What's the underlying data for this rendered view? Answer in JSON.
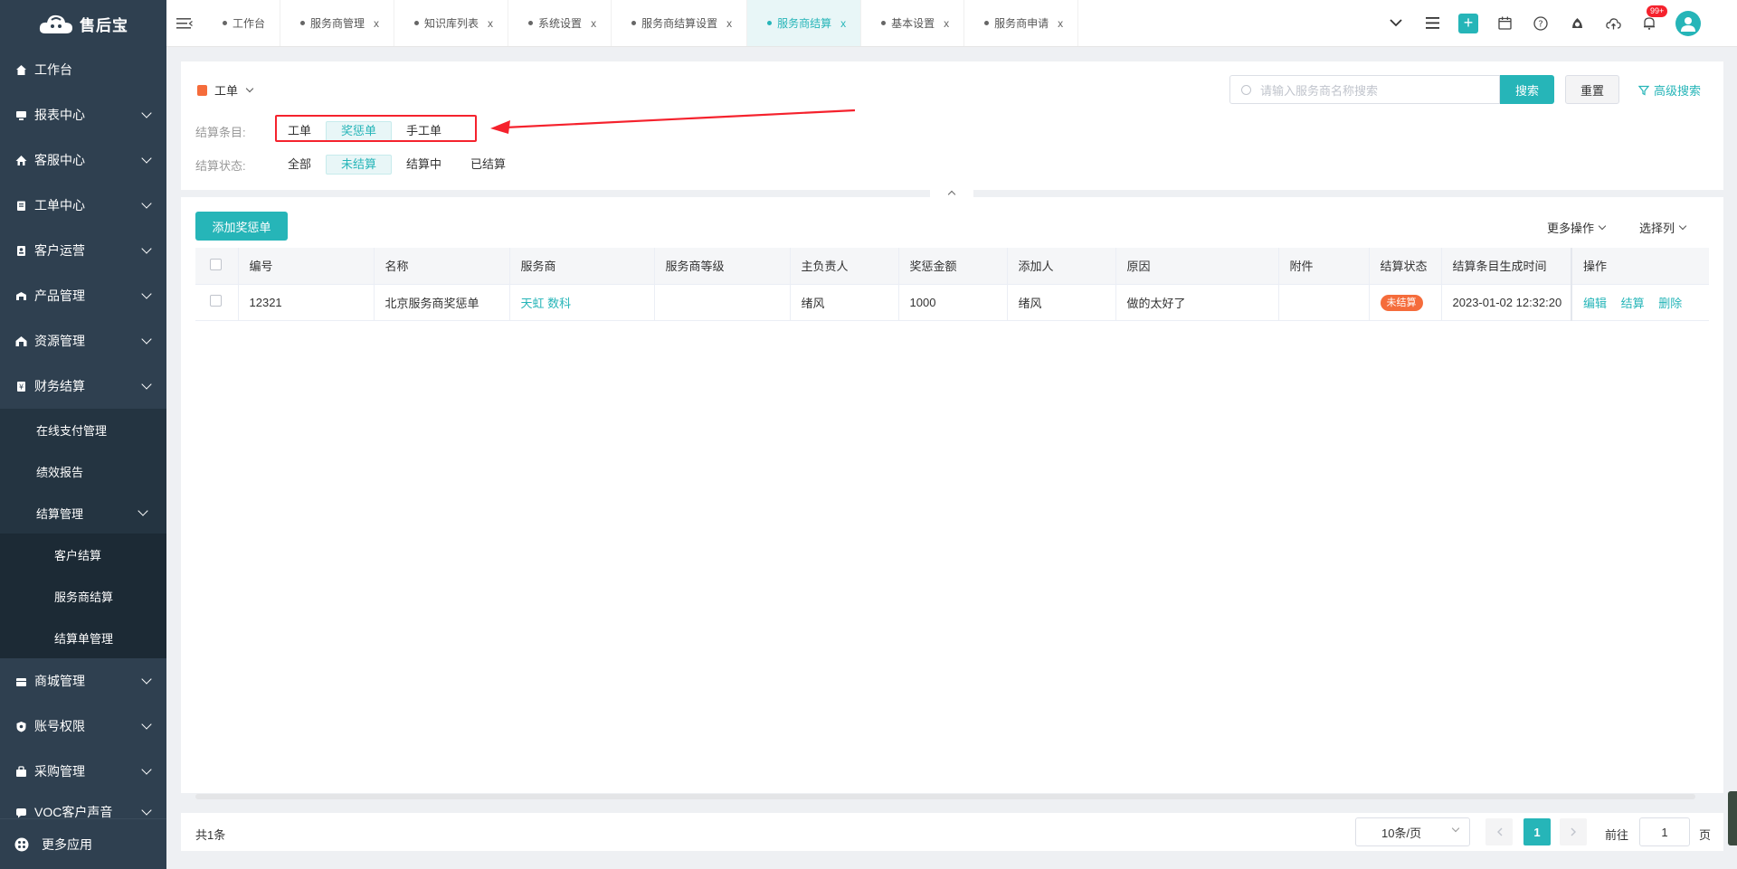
{
  "app": {
    "logo_text": "售后宝"
  },
  "sidebar": {
    "items": [
      {
        "label": "工作台",
        "icon": "home-icon",
        "has_children": false
      },
      {
        "label": "报表中心",
        "icon": "monitor-icon",
        "has_children": true
      },
      {
        "label": "客服中心",
        "icon": "house-icon",
        "has_children": true
      },
      {
        "label": "工单中心",
        "icon": "clipboard-icon",
        "has_children": true
      },
      {
        "label": "客户运营",
        "icon": "contact-icon",
        "has_children": true
      },
      {
        "label": "产品管理",
        "icon": "box-icon",
        "has_children": true
      },
      {
        "label": "资源管理",
        "icon": "warehouse-icon",
        "has_children": true
      },
      {
        "label": "财务结算",
        "icon": "finance-icon",
        "has_children": true
      }
    ],
    "finance_children": [
      {
        "label": "在线支付管理"
      },
      {
        "label": "绩效报告"
      },
      {
        "label": "结算管理"
      }
    ],
    "settlement_children": [
      {
        "label": "客户结算"
      },
      {
        "label": "服务商结算"
      },
      {
        "label": "结算单管理"
      }
    ],
    "items_after": [
      {
        "label": "商城管理",
        "icon": "shop-icon"
      },
      {
        "label": "账号权限",
        "icon": "shield-icon"
      },
      {
        "label": "采购管理",
        "icon": "purchase-icon"
      },
      {
        "label": "VOC客户声音",
        "icon": "voice-icon"
      }
    ],
    "bottom_label": "更多应用"
  },
  "tabs": [
    {
      "label": "工作台",
      "closable": false,
      "active": false
    },
    {
      "label": "服务商管理",
      "closable": true,
      "active": false
    },
    {
      "label": "知识库列表",
      "closable": true,
      "active": false
    },
    {
      "label": "系统设置",
      "closable": true,
      "active": false
    },
    {
      "label": "服务商结算设置",
      "closable": true,
      "active": false
    },
    {
      "label": "服务商结算",
      "closable": true,
      "active": true
    },
    {
      "label": "基本设置",
      "closable": true,
      "active": false
    },
    {
      "label": "服务商申请",
      "closable": true,
      "active": false
    }
  ],
  "header": {
    "notification_badge": "99+"
  },
  "filter": {
    "work_order_select": "工单",
    "search_placeholder": "请输入服务商名称搜索",
    "search_button": "搜索",
    "reset_button": "重置",
    "advanced_search": "高级搜索",
    "item_label": "结算条目:",
    "item_options": [
      "工单",
      "奖惩单",
      "手工单"
    ],
    "item_selected": 1,
    "status_label": "结算状态:",
    "status_options": [
      "全部",
      "未结算",
      "结算中",
      "已结算"
    ],
    "status_selected": 1
  },
  "toolbar": {
    "add_button": "添加奖惩单",
    "more_ops": "更多操作",
    "select_columns": "选择列"
  },
  "table": {
    "columns": [
      "编号",
      "名称",
      "服务商",
      "服务商等级",
      "主负责人",
      "奖惩金额",
      "添加人",
      "原因",
      "附件",
      "结算状态",
      "结算条目生成时间",
      "操作"
    ],
    "rows": [
      {
        "id": "12321",
        "name": "北京服务商奖惩单",
        "provider": "天虹 数科",
        "level": "",
        "owner": "绪风",
        "amount": "1000",
        "added_by": "绪风",
        "reason": "做的太好了",
        "attachment": "",
        "status": "未结算",
        "created_at": "2023-01-02 12:32:20",
        "actions": [
          "编辑",
          "结算",
          "删除"
        ]
      }
    ]
  },
  "pagination": {
    "total": "共1条",
    "page_size": "10条/页",
    "current_page": "1",
    "goto_label": "前往",
    "goto_value": "1",
    "goto_unit": "页"
  },
  "colors": {
    "accent": "#26b5b8",
    "sidebar_bg": "#2f4050",
    "status_unsettled": "#f56c3b",
    "highlight_box": "#f5222d",
    "arrow": "#f5222d"
  }
}
